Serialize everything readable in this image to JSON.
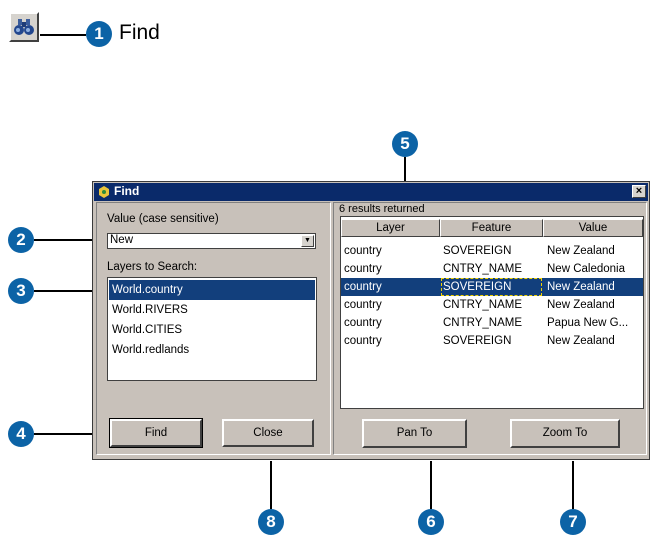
{
  "toolbar": {
    "find_icon": "binoculars-icon",
    "find_label": "Find"
  },
  "callouts": [
    "1",
    "2",
    "3",
    "4",
    "5",
    "6",
    "7",
    "8"
  ],
  "dialog": {
    "title": "Find",
    "close_glyph": "×",
    "value_label": "Value (case sensitive)",
    "value": "New",
    "layers_label": "Layers to Search:",
    "layers": [
      "World.country",
      "World.RIVERS",
      "World.CITIES",
      "World.redlands"
    ],
    "selected_layer": "World.country",
    "find_button": "Find",
    "close_button": "Close",
    "results_status": "6 results returned",
    "columns": [
      "Layer",
      "Feature",
      "Value"
    ],
    "rows": [
      [
        "country",
        "SOVEREIGN",
        "New Zealand"
      ],
      [
        "country",
        "CNTRY_NAME",
        "New Caledonia"
      ],
      [
        "country",
        "SOVEREIGN",
        "New Zealand"
      ],
      [
        "country",
        "CNTRY_NAME",
        "New Zealand"
      ],
      [
        "country",
        "CNTRY_NAME",
        "Papua New G..."
      ],
      [
        "country",
        "SOVEREIGN",
        "New Zealand"
      ]
    ],
    "selected_row": 3,
    "pan_to_button": "Pan To",
    "zoom_to_button": "Zoom To"
  },
  "colors": {
    "callout": "#0c63a6",
    "titlebar": "#0a2a6a",
    "selection": "#123f7c",
    "dialog_face": "#c8c1ba"
  }
}
